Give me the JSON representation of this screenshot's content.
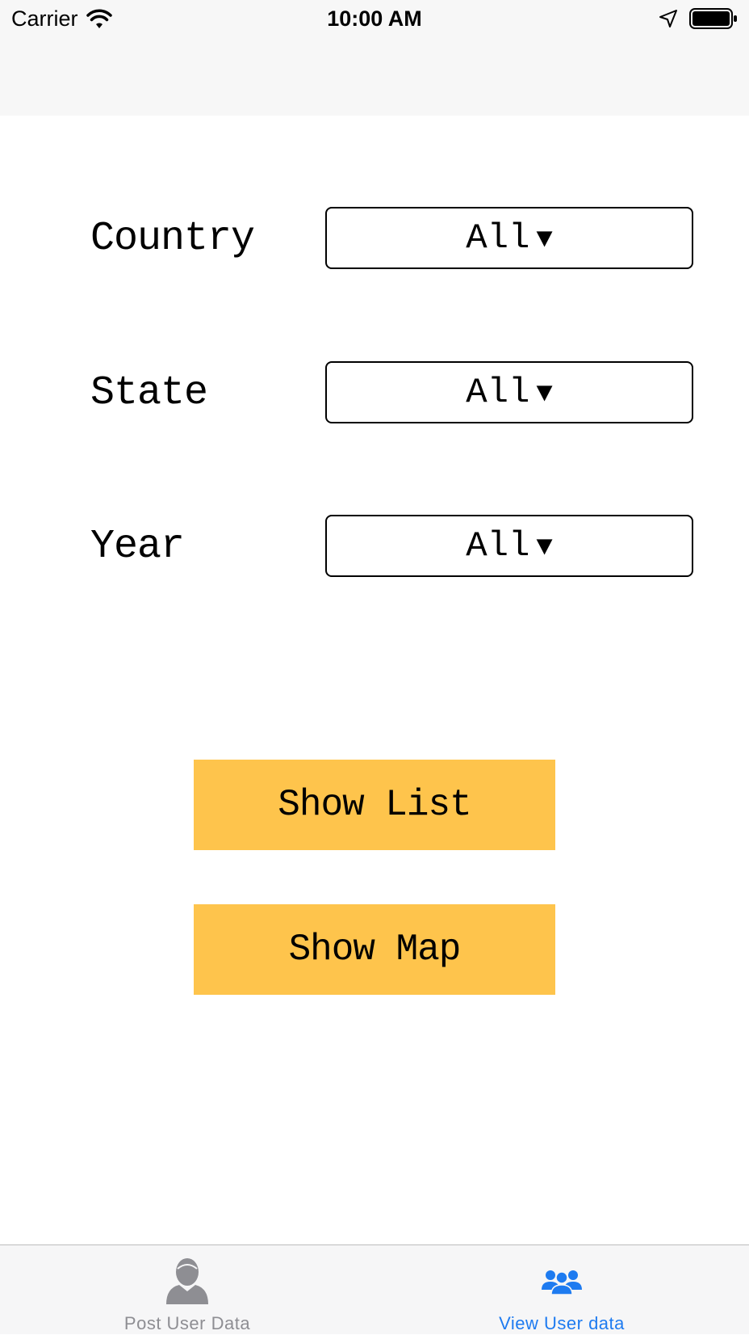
{
  "status_bar": {
    "carrier": "Carrier",
    "time": "10:00 AM",
    "icons": [
      "wifi-icon",
      "location-arrow-icon",
      "battery-icon"
    ]
  },
  "filters": [
    {
      "label": "Country",
      "value": "All",
      "caret": "▼"
    },
    {
      "label": "State",
      "value": "All",
      "caret": "▼"
    },
    {
      "label": "Year",
      "value": "All",
      "caret": "▼"
    }
  ],
  "actions": {
    "show_list": "Show List",
    "show_map": "Show Map",
    "button_color": "#fec44c"
  },
  "tab_bar": {
    "tabs": [
      {
        "label": "Post User Data",
        "icon": "user-icon",
        "active": false,
        "color": "#8e8e93"
      },
      {
        "label": "View User data",
        "icon": "users-group-icon",
        "active": true,
        "color": "#1e7bf0"
      }
    ]
  }
}
